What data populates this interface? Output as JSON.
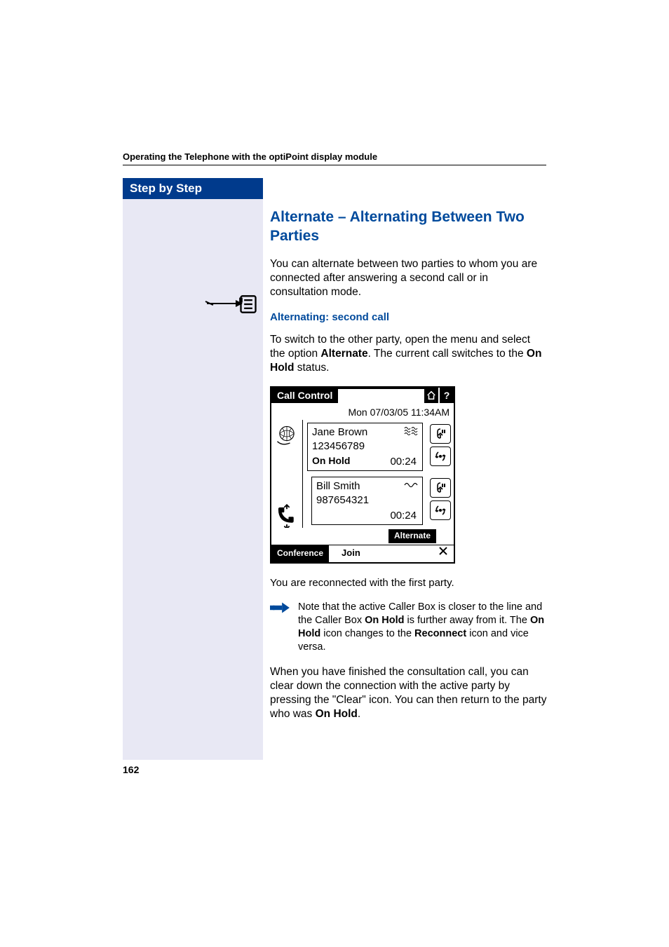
{
  "header": {
    "running_title": "Operating the Telephone with the optiPoint display module"
  },
  "sidebar": {
    "title": "Step by Step"
  },
  "section": {
    "title": "Alternate – Alternating Between Two Parties",
    "intro": "You can alternate between two parties to whom you are connected after answering a second call or in consultation mode.",
    "subheading": "Alternating: second call",
    "switch_pre": "To switch to the other party, open the menu and select the option ",
    "switch_bold1": "Alternate",
    "switch_mid": ". The current call switches to the ",
    "switch_bold2": "On Hold",
    "switch_post": " status.",
    "reconnected": "You are reconnected with the first party.",
    "note_pre": "Note that the active Caller Box is closer to the line and the Caller Box ",
    "note_b1": "On Hold",
    "note_mid1": " is further away from it. The ",
    "note_b2": "On Hold",
    "note_mid2": " icon changes to the ",
    "note_b3": "Reconnect",
    "note_post": " icon and vice versa.",
    "finish_pre": "When you have finished the consultation call, you can clear down the connection with the active party by pressing the \"Clear\" icon. You can then return to the party who was ",
    "finish_bold": "On Hold",
    "finish_post": "."
  },
  "callcontrol": {
    "title": "Call Control",
    "datetime": "Mon 07/03/05 11:34AM",
    "card1": {
      "name": "Jane Brown",
      "number": "123456789",
      "status": "On Hold",
      "time": "00:24"
    },
    "card2": {
      "name": "Bill Smith",
      "number": "987654321",
      "time": "00:24"
    },
    "alternate_label": "Alternate",
    "conference_label": "Conference",
    "join_label": "Join"
  },
  "page_number": "162"
}
